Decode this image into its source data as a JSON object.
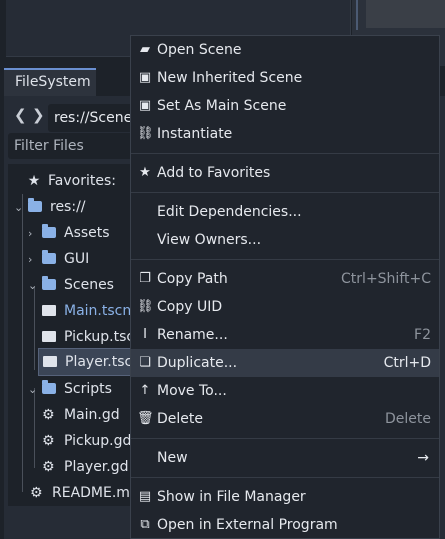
{
  "filesystem_tab": "FileSystem",
  "path": "res://Scenes/",
  "filter_placeholder": "Filter Files",
  "tree": {
    "favorites": "Favorites:",
    "root": "res://",
    "assets": "Assets",
    "gui": "GUI",
    "scenes": "Scenes",
    "main_tscn": "Main.tscn",
    "pickup_tscn": "Pickup.tscn",
    "player_tscn": "Player.tscn",
    "scripts": "Scripts",
    "main_gd": "Main.gd",
    "pickup_gd": "Pickup.gd",
    "player_gd": "Player.gd",
    "readme": "README.md"
  },
  "menu": {
    "open_scene": "Open Scene",
    "new_inherited_scene": "New Inherited Scene",
    "set_as_main_scene": "Set As Main Scene",
    "instantiate": "Instantiate",
    "add_to_favorites": "Add to Favorites",
    "edit_dependencies": "Edit Dependencies...",
    "view_owners": "View Owners...",
    "copy_path": "Copy Path",
    "copy_path_shortcut": "Ctrl+Shift+C",
    "copy_uid": "Copy UID",
    "rename": "Rename...",
    "rename_shortcut": "F2",
    "duplicate": "Duplicate...",
    "duplicate_shortcut": "Ctrl+D",
    "move_to": "Move To...",
    "delete": "Delete",
    "delete_shortcut": "Delete",
    "new": "New",
    "show_in_file_manager": "Show in File Manager",
    "open_in_external_program": "Open in External Program"
  },
  "colors": {
    "accent": "#6a8fd0",
    "folder": "#8ab1e6",
    "panel": "#262c36",
    "menu_bg": "#20252d"
  }
}
